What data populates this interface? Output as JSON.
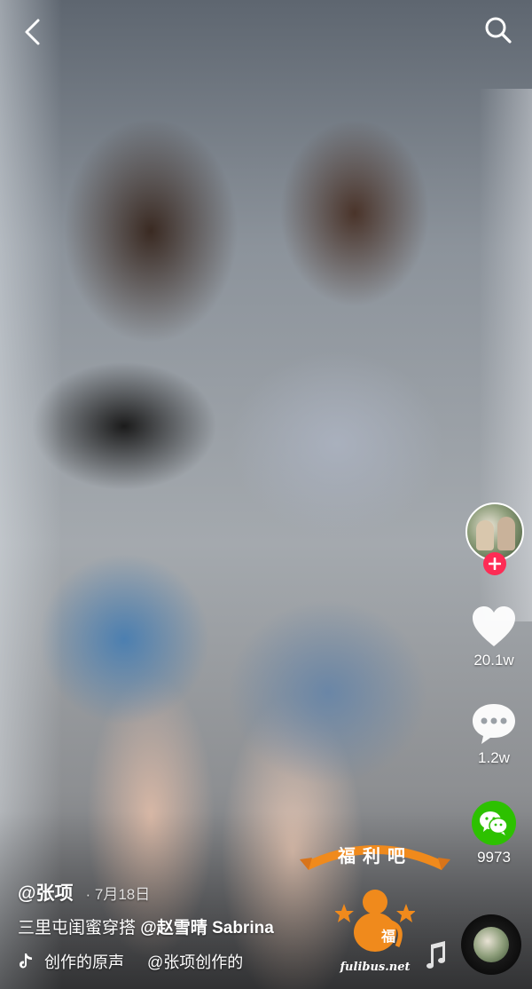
{
  "header": {
    "back_icon": "chevron-left-icon",
    "search_icon": "search-icon"
  },
  "side_actions": {
    "follow_icon": "plus-icon",
    "like": {
      "icon": "heart-icon",
      "count": "20.1w"
    },
    "comment": {
      "icon": "comment-bubble-icon",
      "count": "1.2w"
    },
    "share": {
      "icon": "wechat-icon",
      "count": "9973"
    }
  },
  "caption": {
    "author": "@张项",
    "date": "· 7月18日",
    "description": "三里屯闺蜜穿搭 ",
    "mention": "@赵雪晴 Sabrina",
    "music_icon": "tiktok-note-icon",
    "music_title": "创作的原声",
    "music_author": "@张项创作的"
  },
  "watermark": {
    "title": "福利吧",
    "seal_char": "福",
    "url": "fulibus.net"
  },
  "colors": {
    "accent": "#fe2c55",
    "wechat": "#2dc100",
    "watermark": "#f08a1c"
  }
}
